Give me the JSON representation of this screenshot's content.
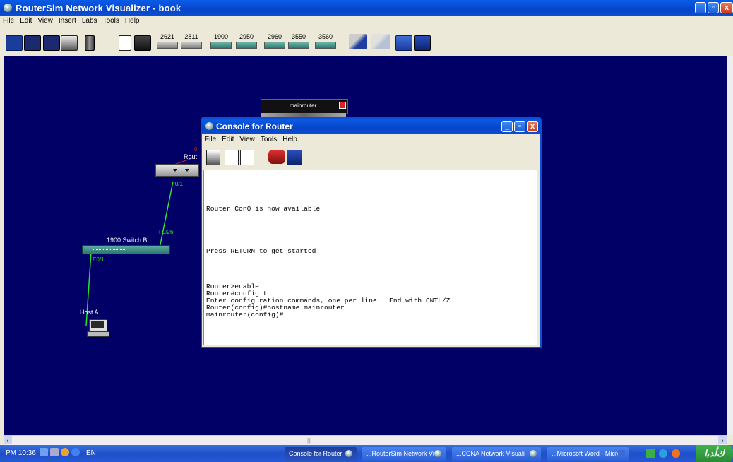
{
  "window": {
    "title": "RouterSim Network Visualizer - book",
    "min": "_",
    "max": "▫",
    "close": "x"
  },
  "menubar": [
    "File",
    "Edit",
    "View",
    "Insert",
    "Labs",
    "Tools",
    "Help"
  ],
  "toolbar": {
    "devices": [
      "2621",
      "2811",
      "1900",
      "2950",
      "2960",
      "3550",
      "3560"
    ]
  },
  "canvas": {
    "mainrouter_label": "mainrouter",
    "router_label": "Rout",
    "router_port": "0",
    "port_f01": "F0/1",
    "port_f026": "F0/26",
    "port_e01": "E0/1",
    "switch_label": "1900 Switch B",
    "host_label": "Host A"
  },
  "console": {
    "title": "Console for Router",
    "menu": [
      "File",
      "Edit",
      "View",
      "Tools",
      "Help"
    ],
    "lines": [
      "",
      "",
      "",
      "",
      "",
      "Router Con0 is now available",
      "",
      "",
      "",
      "",
      "",
      "Press RETURN to get started!",
      "",
      "",
      "",
      "",
      "Router>enable",
      "Router#config t",
      "Enter configuration commands, one per line.  End with CNTL/Z",
      "Router(config)#hostname mainrouter",
      "mainrouter(config)#"
    ]
  },
  "taskbar": {
    "clock": "PM 10:36",
    "lang": "EN",
    "tasks": [
      {
        "label": "Console for Router",
        "active": true
      },
      {
        "label": "...RouterSim Network Vi",
        "active": false
      },
      {
        "label": "...CCNA Network Visuali",
        "active": false
      },
      {
        "label": "...Microsoft Word - Micro",
        "active": false
      }
    ],
    "start": "ﻙﺃﺪﺑﺍ"
  },
  "colors": {
    "canvas_bg": "#000066",
    "link": "#2fe02f",
    "titlebar": "#0a5ce8"
  }
}
